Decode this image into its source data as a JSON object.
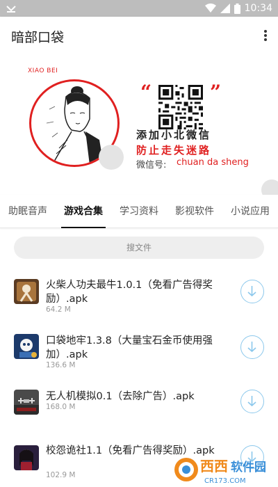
{
  "status_bar": {
    "time": "10:34"
  },
  "app_bar": {
    "title": "暗部口袋"
  },
  "banner": {
    "brand": "XIAO BEI",
    "line1": "添加小北微信",
    "line2": "防止走失迷路",
    "wechat_label": "微信号:",
    "wechat_id": "chuan da sheng"
  },
  "tabs": [
    {
      "label": "助眠音声",
      "active": false
    },
    {
      "label": "游戏合集",
      "active": true
    },
    {
      "label": "学习资料",
      "active": false
    },
    {
      "label": "影视软件",
      "active": false
    },
    {
      "label": "小说应用",
      "active": false
    }
  ],
  "search": {
    "placeholder": "搜文件"
  },
  "files": [
    {
      "name": "火柴人功夫最牛1.0.1（免看广告得奖励）.apk",
      "size": "64.2 M"
    },
    {
      "name": "口袋地牢1.3.8（大量宝石金币使用强加）.apk",
      "size": "136.6 M"
    },
    {
      "name": "无人机模拟0.1（去除广告）.apk",
      "size": "168.0 M"
    },
    {
      "name": "校怨诡社1.1（免看广告得奖励）.apk",
      "size": "102.9 M"
    }
  ],
  "watermark": {
    "text": "西西软件园",
    "url_text": "CR173.COM"
  },
  "colors": {
    "accent_red": "#e02020",
    "download_blue": "#8cc8ec",
    "status_bar": "#bdbdbd"
  }
}
